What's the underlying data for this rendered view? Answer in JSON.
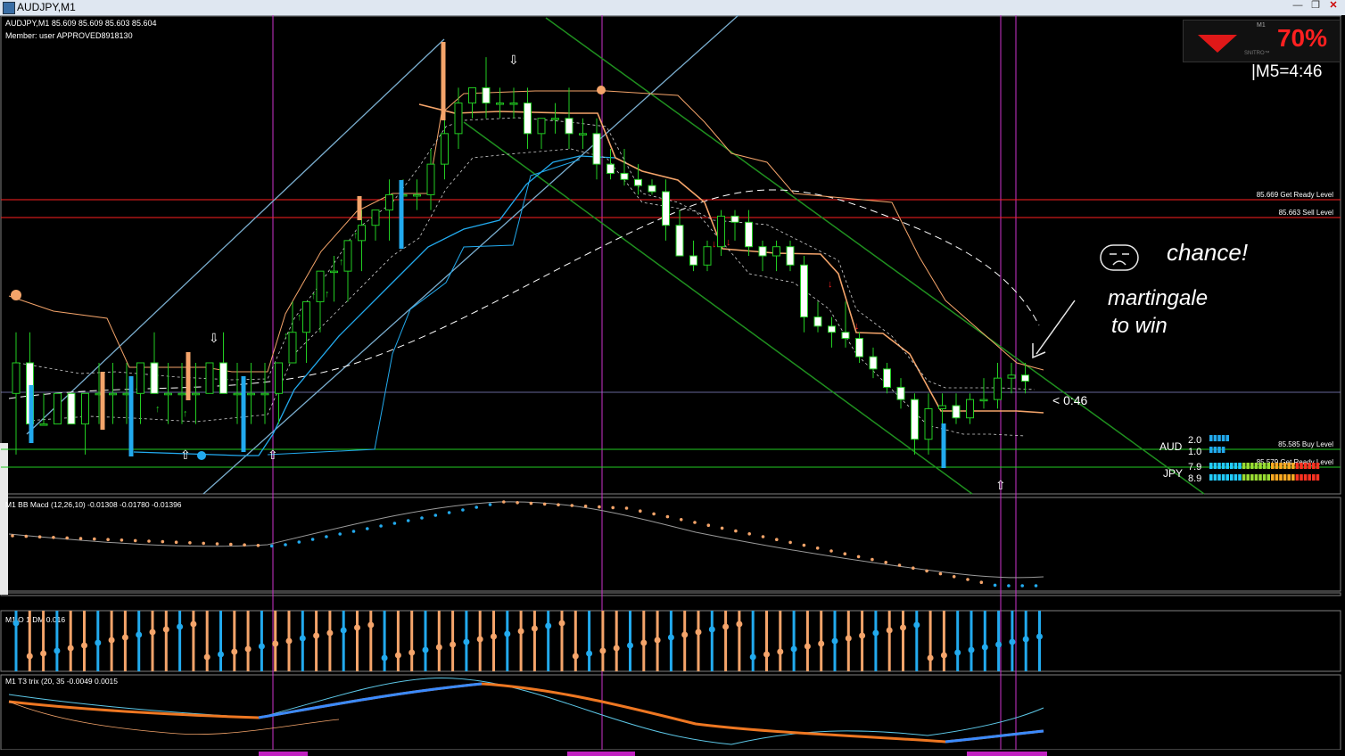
{
  "window": {
    "title": "AUDJPY,M1"
  },
  "chart_header": {
    "line1": "AUDJPY,M1  85.609 85.609 85.603 85.604",
    "line2": "Member:  user   APPROVED8918130"
  },
  "badge": {
    "timeframe": "M1",
    "percent": "70%",
    "brand": "SNITRO™",
    "direction": "down"
  },
  "timer_text": "|M5=4:46",
  "countdown_label": "< 0:46",
  "levels": [
    {
      "label": "85.669 Get Ready Level",
      "color": "#ff3030"
    },
    {
      "label": "85.663 Sell Level",
      "color": "#ff3030"
    },
    {
      "label": "85.585 Buy Level",
      "color": "#22cc22"
    },
    {
      "label": "85.579 Get Ready Level",
      "color": "#22cc22"
    }
  ],
  "currency_strength": [
    {
      "name": "AUD",
      "values": [
        "2.0",
        "1.0"
      ],
      "color": "#22cc22"
    },
    {
      "name": "JPY",
      "values": [
        "7.9",
        "8.9"
      ],
      "color": "#22cc22"
    }
  ],
  "annotation": {
    "line1": "chance!",
    "line2": "martingale",
    "line3": "to win",
    "face": ":("
  },
  "indicators": {
    "macd": "M1 BB Macd (12,26,10) -0.01308 -0.01780 -0.01396",
    "osc": "M1 O 1  DM 0.016",
    "trix": "M1 T3 trix (20, 35 -0.0049 0.0015"
  },
  "colors": {
    "up_candle": "#000000",
    "down_candle": "#ffffff",
    "wick": "#22cc22",
    "accent_blue": "#22aaee",
    "accent_orange": "#f4a46a",
    "vline": "#cc33cc"
  },
  "chart_data": {
    "type": "candlestick",
    "symbol": "AUDJPY",
    "timeframe": "M1",
    "last_bid": 85.604,
    "levels": [
      85.669,
      85.663,
      85.585,
      85.579
    ],
    "candles": [
      [
        85.6,
        85.62,
        85.58,
        85.61
      ],
      [
        85.61,
        85.62,
        85.59,
        85.59
      ],
      [
        85.59,
        85.6,
        85.59,
        85.59
      ],
      [
        85.59,
        85.6,
        85.59,
        85.6
      ],
      [
        85.6,
        85.6,
        85.59,
        85.59
      ],
      [
        85.59,
        85.6,
        85.58,
        85.6
      ],
      [
        85.6,
        85.61,
        85.59,
        85.6
      ],
      [
        85.6,
        85.61,
        85.59,
        85.6
      ],
      [
        85.6,
        85.61,
        85.59,
        85.6
      ],
      [
        85.6,
        85.61,
        85.59,
        85.61
      ],
      [
        85.61,
        85.62,
        85.6,
        85.6
      ],
      [
        85.6,
        85.61,
        85.59,
        85.6
      ],
      [
        85.6,
        85.61,
        85.59,
        85.6
      ],
      [
        85.6,
        85.61,
        85.59,
        85.6
      ],
      [
        85.6,
        85.61,
        85.6,
        85.61
      ],
      [
        85.61,
        85.62,
        85.6,
        85.6
      ],
      [
        85.6,
        85.61,
        85.59,
        85.6
      ],
      [
        85.6,
        85.61,
        85.59,
        85.6
      ],
      [
        85.6,
        85.61,
        85.59,
        85.6
      ],
      [
        85.6,
        85.61,
        85.59,
        85.61
      ],
      [
        85.61,
        85.63,
        85.61,
        85.62
      ],
      [
        85.62,
        85.63,
        85.61,
        85.63
      ],
      [
        85.63,
        85.64,
        85.62,
        85.64
      ],
      [
        85.64,
        85.645,
        85.63,
        85.64
      ],
      [
        85.64,
        85.65,
        85.63,
        85.65
      ],
      [
        85.65,
        85.66,
        85.64,
        85.655
      ],
      [
        85.655,
        85.66,
        85.65,
        85.66
      ],
      [
        85.66,
        85.67,
        85.65,
        85.665
      ],
      [
        85.665,
        85.67,
        85.66,
        85.665
      ],
      [
        85.665,
        85.67,
        85.66,
        85.665
      ],
      [
        85.665,
        85.68,
        85.66,
        85.675
      ],
      [
        85.675,
        85.69,
        85.67,
        85.685
      ],
      [
        85.685,
        85.7,
        85.68,
        85.695
      ],
      [
        85.695,
        85.7,
        85.69,
        85.7
      ],
      [
        85.7,
        85.71,
        85.69,
        85.695
      ],
      [
        85.695,
        85.7,
        85.69,
        85.695
      ],
      [
        85.695,
        85.7,
        85.69,
        85.695
      ],
      [
        85.695,
        85.7,
        85.68,
        85.685
      ],
      [
        85.685,
        85.69,
        85.68,
        85.69
      ],
      [
        85.69,
        85.695,
        85.685,
        85.69
      ],
      [
        85.69,
        85.7,
        85.68,
        85.685
      ],
      [
        85.685,
        85.69,
        85.68,
        85.685
      ],
      [
        85.685,
        85.69,
        85.67,
        85.675
      ],
      [
        85.675,
        85.68,
        85.67,
        85.672
      ],
      [
        85.672,
        85.68,
        85.668,
        85.67
      ],
      [
        85.67,
        85.675,
        85.665,
        85.668
      ],
      [
        85.668,
        85.67,
        85.665,
        85.666
      ],
      [
        85.666,
        85.67,
        85.65,
        85.655
      ],
      [
        85.655,
        85.66,
        85.645,
        85.645
      ],
      [
        85.645,
        85.65,
        85.64,
        85.642
      ],
      [
        85.642,
        85.65,
        85.64,
        85.648
      ],
      [
        85.648,
        85.66,
        85.645,
        85.658
      ],
      [
        85.658,
        85.66,
        85.65,
        85.656
      ],
      [
        85.656,
        85.66,
        85.645,
        85.648
      ],
      [
        85.648,
        85.65,
        85.64,
        85.645
      ],
      [
        85.645,
        85.65,
        85.64,
        85.648
      ],
      [
        85.648,
        85.65,
        85.64,
        85.642
      ],
      [
        85.642,
        85.645,
        85.62,
        85.625
      ],
      [
        85.625,
        85.63,
        85.62,
        85.622
      ],
      [
        85.622,
        85.625,
        85.615,
        85.62
      ],
      [
        85.62,
        85.63,
        85.615,
        85.618
      ],
      [
        85.618,
        85.62,
        85.61,
        85.612
      ],
      [
        85.612,
        85.615,
        85.605,
        85.608
      ],
      [
        85.608,
        85.61,
        85.6,
        85.602
      ],
      [
        85.602,
        85.605,
        85.595,
        85.598
      ],
      [
        85.598,
        85.6,
        85.58,
        85.585
      ],
      [
        85.585,
        85.6,
        85.58,
        85.595
      ],
      [
        85.595,
        85.6,
        85.59,
        85.596
      ],
      [
        85.596,
        85.6,
        85.59,
        85.592
      ],
      [
        85.592,
        85.6,
        85.59,
        85.598
      ],
      [
        85.598,
        85.605,
        85.595,
        85.598
      ],
      [
        85.598,
        85.61,
        85.595,
        85.605
      ],
      [
        85.605,
        85.61,
        85.6,
        85.606
      ],
      [
        85.606,
        85.61,
        85.6,
        85.604
      ]
    ]
  }
}
